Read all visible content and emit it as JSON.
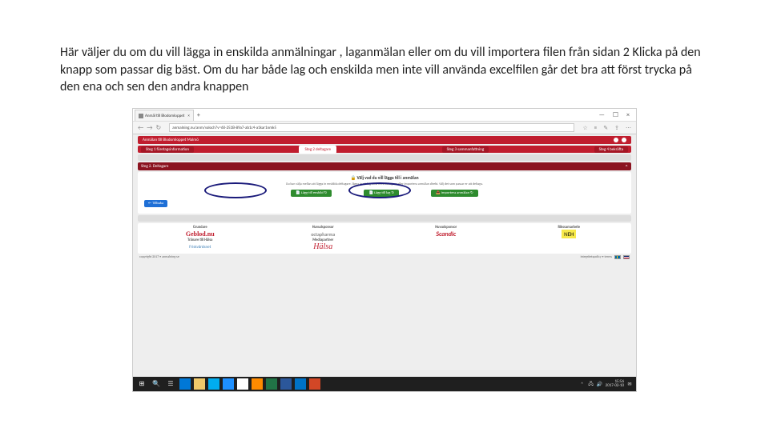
{
  "doc_paragraph": "Här väljer du om du vill lägga in enskilda anmälningar , laganmälan eller om du vill importera filen från sidan 2 Klicka på den knapp som passar dig bäst. Om du har både lag och enskilda men inte vill använda excelfilen går det bra att först trycka på den ena och sen den andra knappen",
  "browser": {
    "tab_title": "Anmäl till Blodomloppet",
    "tab_close": "×",
    "plus": "+",
    "win_min": "—",
    "win_max": "☐",
    "win_close": "×",
    "nav_back": "←",
    "nav_fwd": "→",
    "nav_reload": "↻",
    "url": "anmalning.nu/anm/valoch?v=60-251B-89a7-ab1c4-a1kar1nmk5",
    "icon_star": "☆",
    "icon_menu": "≡",
    "icon_note": "✎",
    "icon_share": "⇪",
    "icon_more": "⋯"
  },
  "page": {
    "band1_left": "Anmälan till Blodomloppet Malmö",
    "pill1": "Steg 1 företagsinformation",
    "pill2": "Steg 2 deltagare",
    "pill3": "Steg 3 sammanfattning",
    "pill4": "Steg 4 bekräfta",
    "step_row": "Steg 2. Deltagare",
    "card_title": "🔒 Välj vad du vill lägga till i anmälan",
    "card_desc": "Du kan välja mellan att lägga in enskilda deltagare, lägga in ett lag med flera deltagare eller importera anmälan direkt. Välj det som passar er att deltaga.",
    "btn_enskild": "📄 Lägg till enskild ↻",
    "btn_lag": "📄 Lägg till lag ↻",
    "btn_import": "📥 Importera anmälan ↻",
    "back_btn": "← Tillbaka"
  },
  "sponsors": {
    "cat1": "Grundare",
    "cat2": "Huvudsponsor",
    "cat3": "Huvudsponsor",
    "cat4": "Rikssamarbete",
    "geblod": "Geblod.nu",
    "octa": "octapharma",
    "scandic": "Scandic",
    "neh": "NEH",
    "cat5": "Tränare till Hälsa",
    "cat6": "Mediapartner",
    "frisk": "Friskvårdsnet",
    "halsa": "Hälsa",
    "footer_left": "copyright 2017 • anmalning.se",
    "footer_right": "integritetspolicy • terms"
  },
  "taskbar": {
    "time": "15:56",
    "date": "2017-02-10",
    "tray_up": "˄",
    "tray_net": "🖧",
    "tray_vol": "🔊",
    "tray_note": "✉"
  }
}
